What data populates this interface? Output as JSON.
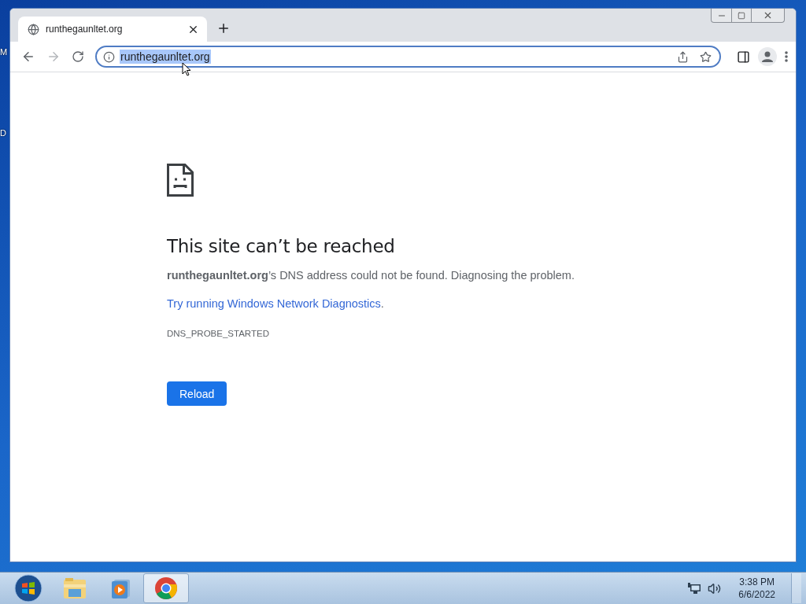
{
  "desktop": {
    "icon_labels": [
      "M",
      "D"
    ]
  },
  "tabs": [
    {
      "title": "runthegaunltet.org",
      "selected": true
    }
  ],
  "toolbar": {
    "back": {
      "disabled": false
    },
    "forward": {
      "disabled": true
    }
  },
  "address_bar": {
    "value": "runthegaunltet.org",
    "selected": true,
    "focused": true
  },
  "error_page": {
    "heading": "This site can’t be reached",
    "message": "**runthegaunltet.org**’s DNS address could not be found. Diagnosing the problem.",
    "suggestion": {
      "link": "Try running Windows Network Diagnostics",
      "after": "."
    },
    "error_code": "DNS_PROBE_STARTED",
    "button": "Reload"
  },
  "taskbar": {
    "apps": [
      {
        "kind": "explorer",
        "selected": false
      },
      {
        "kind": "media",
        "selected": false
      },
      {
        "kind": "chrome",
        "selected": true
      }
    ],
    "clock": {
      "time": "3:38 PM",
      "date": "6/6/2022"
    }
  }
}
